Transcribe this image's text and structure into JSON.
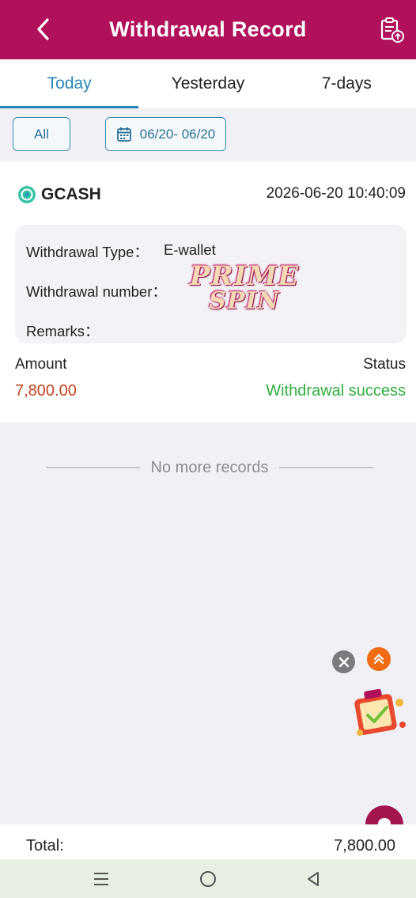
{
  "header": {
    "title": "Withdrawal Record",
    "back_icon": "chevron-left-icon",
    "action_icon": "clipboard-upload-icon"
  },
  "tabs": [
    {
      "label": "Today",
      "active": true
    },
    {
      "label": "Yesterday",
      "active": false
    },
    {
      "label": "7-days",
      "active": false
    }
  ],
  "filters": {
    "type_label": "All",
    "date_range": "06/20- 06/20"
  },
  "record": {
    "method": "GCASH",
    "datetime": "2026-06-20 10:40:09",
    "type_label": "Withdrawal Type：",
    "type_value": "E-wallet",
    "number_label": "Withdrawal number：",
    "number_value": "",
    "remarks_label": "Remarks：",
    "remarks_value": "",
    "amount_label": "Amount",
    "amount_value": "7,800.00",
    "status_label": "Status",
    "status_value": "Withdrawal success"
  },
  "watermark": {
    "line1": "PRIME",
    "line2": "SPIN"
  },
  "list_end_text": "No more records",
  "footer": {
    "total_label": "Total:",
    "total_value": "7,800.00"
  },
  "colors": {
    "brand": "#b0115a",
    "tab_active": "#2a87b8",
    "amount": "#c24422",
    "success": "#2fae3e"
  }
}
